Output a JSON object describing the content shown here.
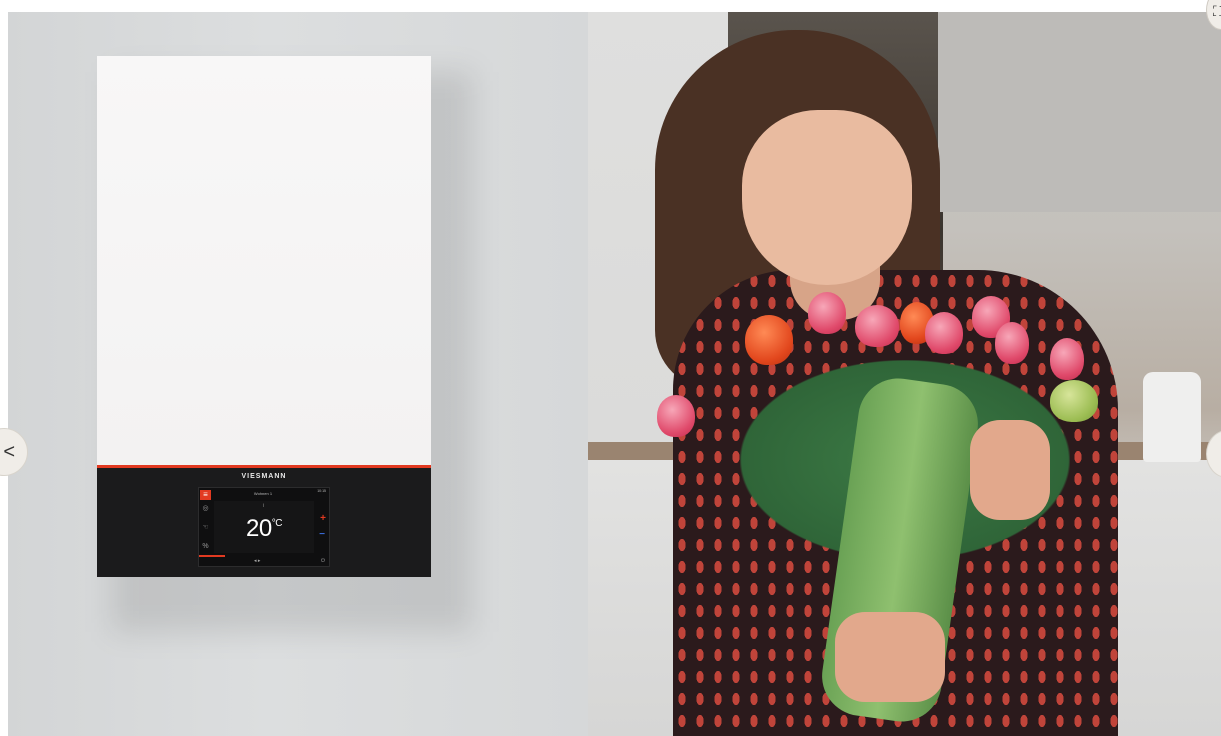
{
  "carousel": {
    "prev_icon": "<",
    "next_icon": "",
    "corner_icon": "⛶"
  },
  "boiler": {
    "brand": "VIESMANN",
    "menu_glyph": "≡",
    "header_label": "Wohnen 1",
    "time_label": "10:15",
    "small_label": "i",
    "temperature": "20",
    "temperature_unit": "°C",
    "plus": "+",
    "minus": "−",
    "nav_arrows": "◂ ▸",
    "power_glyph": "⏻"
  },
  "colors": {
    "accent_red": "#e23a21",
    "boiler_front": "#f8f7f7",
    "boiler_panel": "#1b1b1c"
  }
}
